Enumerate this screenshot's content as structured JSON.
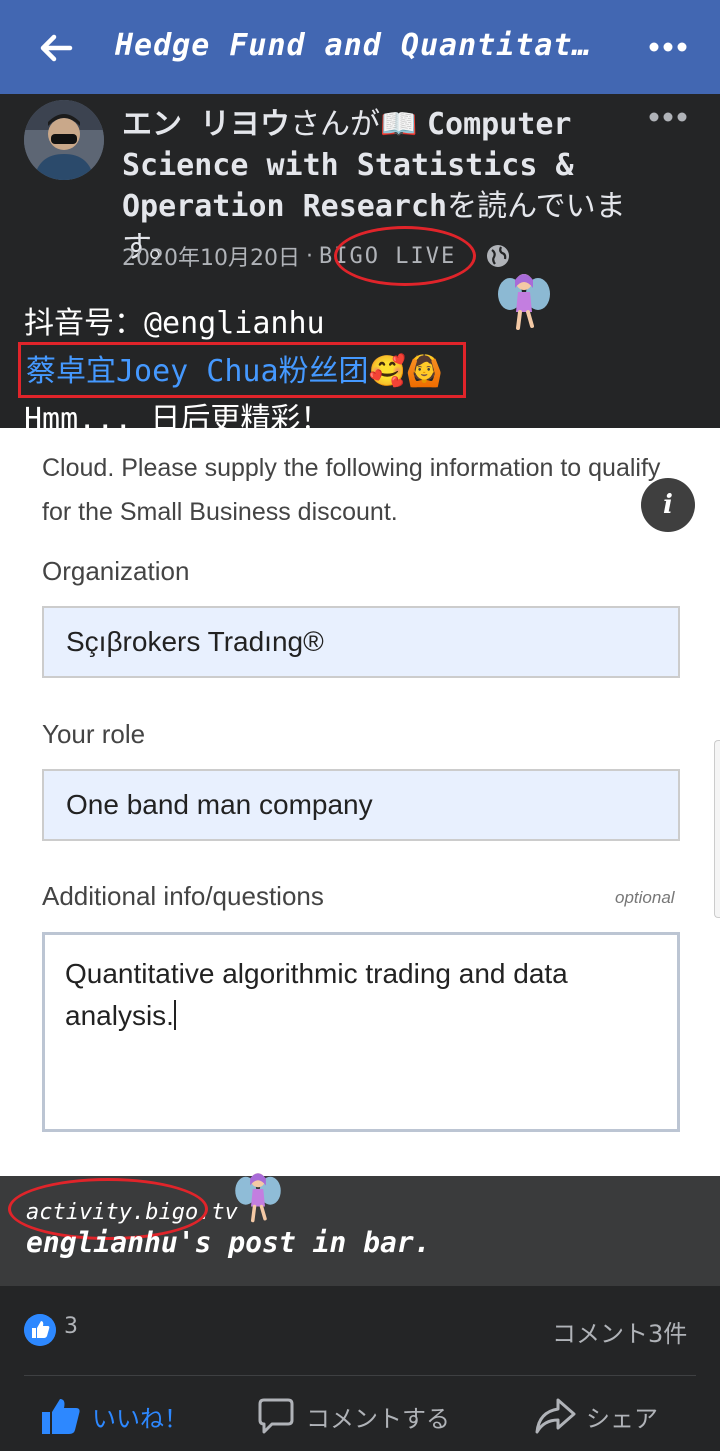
{
  "topbar": {
    "title": "Hedge Fund and Quantitati…",
    "back_icon": "arrow-left-icon",
    "more_icon": "more-horizontal-icon"
  },
  "post": {
    "author": "エン リヨウ",
    "headline_suffix_1": "さんが📖 ",
    "book_title": "Computer Science with Statistics & Operation Research",
    "headline_suffix_2": "を読んでいます。",
    "date": "2020年10月20日",
    "separator": "·",
    "app_name": "BIGO LIVE",
    "body_line1": "抖音号：@englianhu",
    "fan_club_link": "蔡卓宜Joey Chua粉丝团",
    "fan_club_emoji": "🥰🙆",
    "body_line3": "Hmm... 日后更精彩！"
  },
  "shared_screenshot": {
    "intro": "Cloud. Please supply the following information to qualify for the Small Business discount.",
    "info_button": "i",
    "organization_label": "Organization",
    "organization_value": "Sçıβrokers Tradıng®",
    "role_label": "Your role",
    "role_value": "One band man company",
    "additional_label": "Additional info/questions",
    "optional_label": "optional",
    "additional_value": "Quantitative algorithmic trading and data analysis."
  },
  "link_preview": {
    "domain": "activity.bigo.tv",
    "caption": "englianhu's post in bar."
  },
  "stats": {
    "like_count": "3",
    "comment_count": "コメント3件"
  },
  "actions": {
    "like": "いいね！",
    "comment": "コメントする",
    "share": "シェア"
  },
  "colors": {
    "header_blue": "#4267b2",
    "dark_bg": "#242526",
    "link_blue": "#4599ff",
    "annotation_red": "#e0242a",
    "like_blue": "#2d88ff"
  }
}
